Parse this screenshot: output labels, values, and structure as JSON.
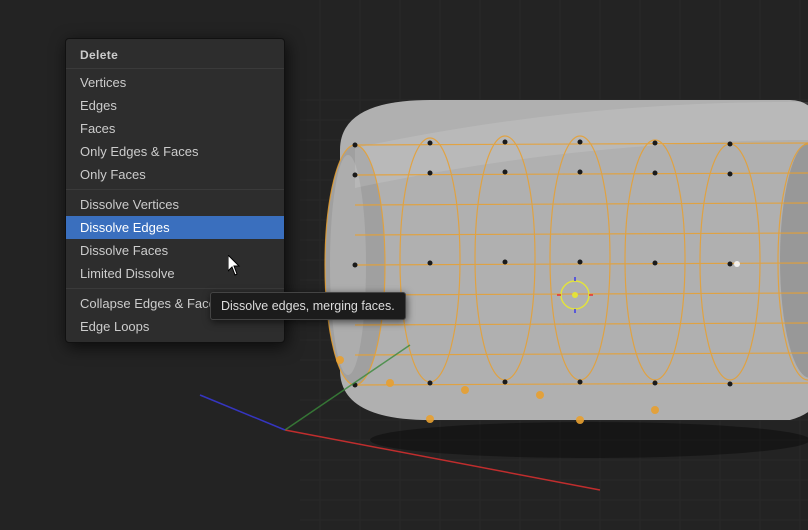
{
  "menu": {
    "title": "Delete",
    "items": [
      {
        "label": "Vertices",
        "id": "vertices",
        "active": false,
        "separator_after": false
      },
      {
        "label": "Edges",
        "id": "edges",
        "active": false,
        "separator_after": false
      },
      {
        "label": "Faces",
        "id": "faces",
        "active": false,
        "separator_after": false
      },
      {
        "label": "Only Edges & Faces",
        "id": "only-edges-faces",
        "active": false,
        "separator_after": false
      },
      {
        "label": "Only Faces",
        "id": "only-faces",
        "active": false,
        "separator_after": true
      },
      {
        "label": "Dissolve Vertices",
        "id": "dissolve-vertices",
        "active": false,
        "separator_after": false
      },
      {
        "label": "Dissolve Edges",
        "id": "dissolve-edges",
        "active": true,
        "separator_after": false
      },
      {
        "label": "Dissolve Faces",
        "id": "dissolve-faces",
        "active": false,
        "separator_after": false
      },
      {
        "label": "Limited Dissolve",
        "id": "limited-dissolve",
        "active": false,
        "separator_after": true
      },
      {
        "label": "Collapse Edges & Faces",
        "id": "collapse-edges-faces",
        "active": false,
        "separator_after": false
      },
      {
        "label": "Edge Loops",
        "id": "edge-loops",
        "active": false,
        "separator_after": false
      }
    ]
  },
  "tooltip": {
    "text": "Dissolve edges, merging faces."
  },
  "viewport": {
    "background_color": "#232323"
  }
}
